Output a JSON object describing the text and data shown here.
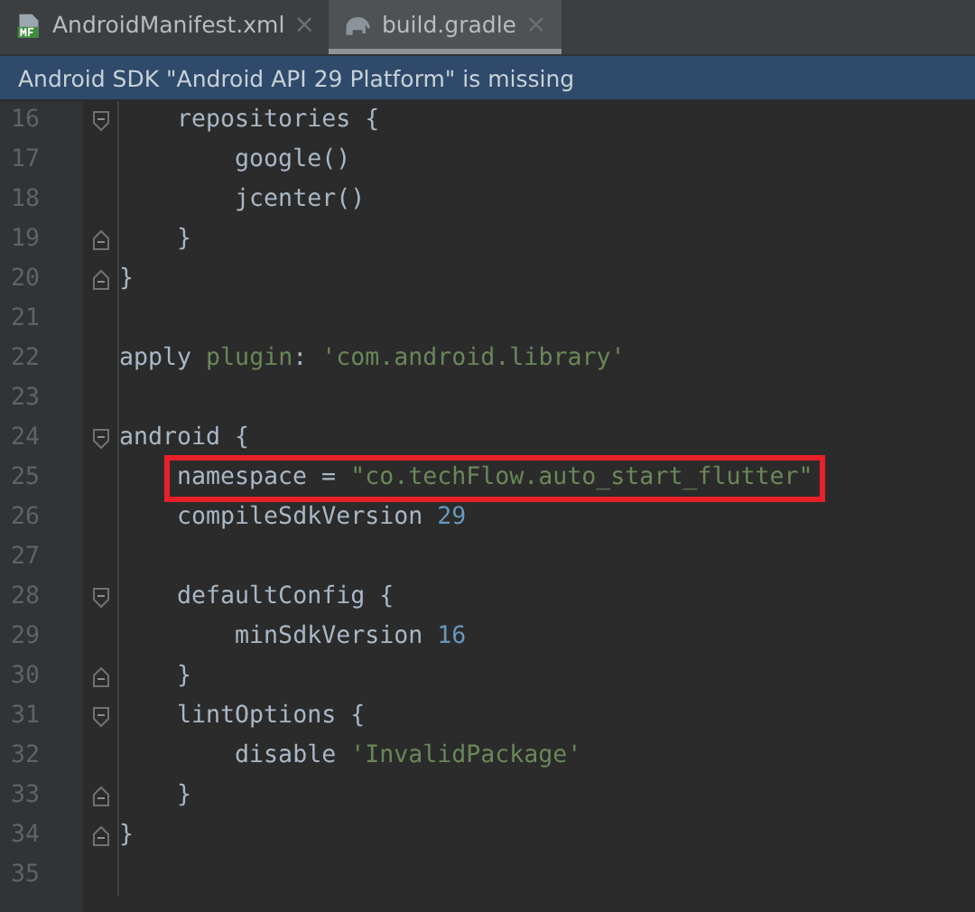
{
  "tabs": [
    {
      "label": "AndroidManifest.xml",
      "kind": "manifest",
      "selected": false,
      "close": "×"
    },
    {
      "label": "build.gradle",
      "kind": "gradle",
      "selected": true,
      "close": "×"
    }
  ],
  "banner": {
    "text": "Android SDK \"Android API 29 Platform\" is missing"
  },
  "editor": {
    "lines": [
      {
        "number": "16",
        "kind": "block-start",
        "tokens": [
          {
            "text": "    repositories {",
            "kind": "plain"
          }
        ]
      },
      {
        "number": "17",
        "kind": "line",
        "tokens": [
          {
            "text": "        google()",
            "kind": "plain"
          }
        ]
      },
      {
        "number": "18",
        "kind": "line",
        "tokens": [
          {
            "text": "        jcenter()",
            "kind": "plain"
          }
        ]
      },
      {
        "number": "19",
        "kind": "block-end",
        "tokens": [
          {
            "text": "    }",
            "kind": "plain"
          }
        ]
      },
      {
        "number": "20",
        "kind": "block-end",
        "tokens": [
          {
            "text": "}",
            "kind": "plain"
          }
        ]
      },
      {
        "number": "21",
        "kind": "blank"
      },
      {
        "number": "22",
        "kind": "line",
        "tokens": [
          {
            "text": "apply ",
            "kind": "plain"
          },
          {
            "text": "plugin",
            "kind": "named-arg"
          },
          {
            "text": ": ",
            "kind": "plain"
          },
          {
            "text": "'com.android.library'",
            "kind": "string"
          }
        ]
      },
      {
        "number": "23",
        "kind": "blank"
      },
      {
        "number": "24",
        "kind": "block-start",
        "tokens": [
          {
            "text": "android {",
            "kind": "plain"
          }
        ]
      },
      {
        "number": "25",
        "kind": "line",
        "highlighted": true,
        "tokens": [
          {
            "text": "namespace = ",
            "kind": "plain"
          },
          {
            "text": "\"co.techFlow.auto_start_flutter\"",
            "kind": "string"
          }
        ]
      },
      {
        "number": "26",
        "kind": "line",
        "tokens": [
          {
            "text": "    compileSdkVersion ",
            "kind": "plain"
          },
          {
            "text": "29",
            "kind": "number"
          }
        ]
      },
      {
        "number": "27",
        "kind": "blank"
      },
      {
        "number": "28",
        "kind": "block-start",
        "tokens": [
          {
            "text": "    defaultConfig {",
            "kind": "plain"
          }
        ]
      },
      {
        "number": "29",
        "kind": "line",
        "tokens": [
          {
            "text": "        minSdkVersion ",
            "kind": "plain"
          },
          {
            "text": "16",
            "kind": "number"
          }
        ]
      },
      {
        "number": "30",
        "kind": "block-end",
        "tokens": [
          {
            "text": "    }",
            "kind": "plain"
          }
        ]
      },
      {
        "number": "31",
        "kind": "block-start",
        "tokens": [
          {
            "text": "    lintOptions {",
            "kind": "plain"
          }
        ]
      },
      {
        "number": "32",
        "kind": "line",
        "tokens": [
          {
            "text": "        disable ",
            "kind": "plain"
          },
          {
            "text": "'InvalidPackage'",
            "kind": "string"
          }
        ]
      },
      {
        "number": "33",
        "kind": "block-end",
        "tokens": [
          {
            "text": "    }",
            "kind": "plain"
          }
        ]
      },
      {
        "number": "34",
        "kind": "block-end",
        "tokens": [
          {
            "text": "}",
            "kind": "plain"
          }
        ]
      },
      {
        "number": "35",
        "kind": "blank"
      }
    ]
  }
}
